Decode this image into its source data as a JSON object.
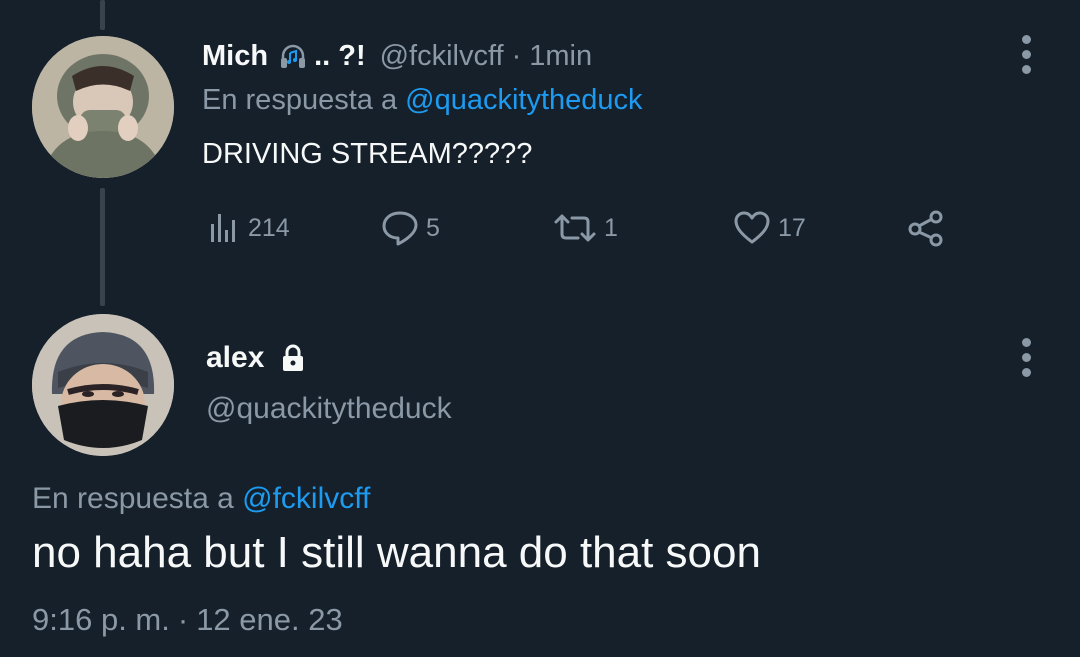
{
  "parent_tweet": {
    "display_name": "Mich",
    "name_suffix": ".. ?!",
    "handle": "@fckilvcff",
    "separator": "·",
    "time": "1min",
    "reply_prefix": "En respuesta a",
    "reply_mention": "@quackitytheduck",
    "text": "DRIVING STREAM?????",
    "stats": {
      "views": "214",
      "replies": "5",
      "retweets": "1",
      "likes": "17"
    }
  },
  "main_tweet": {
    "display_name": "alex",
    "handle": "@quackitytheduck",
    "reply_prefix": "En respuesta a",
    "reply_mention": "@fckilvcff",
    "text": "no haha but I still wanna do that soon",
    "time": "9:16 p. m.",
    "separator": "·",
    "date": "12 ene. 23"
  },
  "icons": {
    "headphones": "headphones-icon",
    "lock": "lock-icon",
    "views": "bar-chart-icon",
    "reply": "speech-bubble-icon",
    "retweet": "retweet-icon",
    "like": "heart-icon",
    "share": "share-icon",
    "more": "more-vertical-icon"
  },
  "colors": {
    "background": "#15202b",
    "primary_text": "#f7f9f9",
    "secondary_text": "#8b98a5",
    "accent": "#1d9bf0",
    "thread_line": "#38444d"
  }
}
